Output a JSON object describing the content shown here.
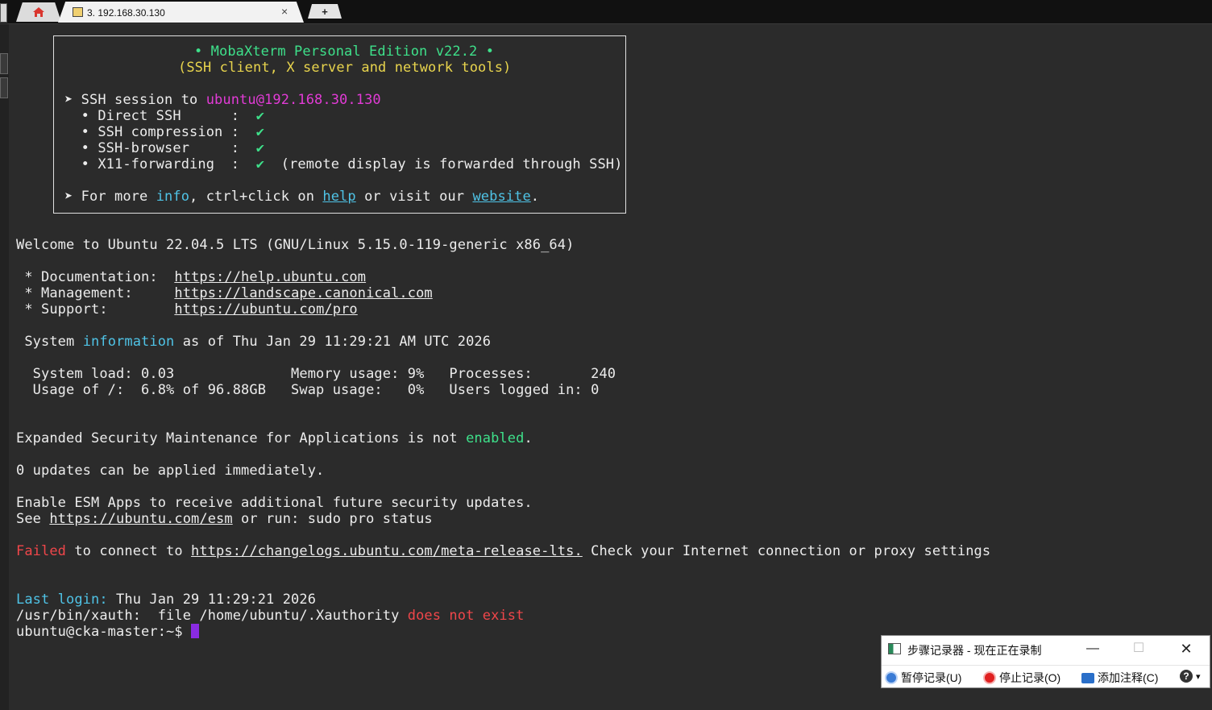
{
  "tabs": {
    "home_icon": "home-icon",
    "session_title": "3. 192.168.30.130",
    "close_glyph": "×",
    "new_tab_glyph": "+"
  },
  "banner": {
    "l1": "• MobaXterm Personal Edition v22.2 •",
    "l2": "(SSH client, X server and network tools)",
    "l3_pre": "➤ SSH session to ",
    "l3_host": "ubuntu@192.168.30.130",
    "l4_label": "  • Direct SSH      :  ",
    "l5_label": "  • SSH compression :  ",
    "l6_label": "  • SSH-browser     :  ",
    "l7_label": "  • X11-forwarding  :  ",
    "check": "✔",
    "l7_note": "  (remote display is forwarded through SSH)",
    "l8_pre": "➤ For more ",
    "l8_info": "info",
    "l8_mid": ", ctrl+click on ",
    "l8_help": "help",
    "l8_mid2": " or visit our ",
    "l8_website": "website",
    "l8_end": "."
  },
  "motd": {
    "welcome": "Welcome to Ubuntu 22.04.5 LTS (GNU/Linux 5.15.0-119-generic x86_64)",
    "doc_label": " * Documentation:  ",
    "doc_url": "https://help.ubuntu.com",
    "mgmt_label": " * Management:     ",
    "mgmt_url": "https://landscape.canonical.com",
    "support_label": " * Support:        ",
    "support_url": "https://ubuntu.com/pro",
    "sysinfo_pre": " System ",
    "sysinfo_word": "information",
    "sysinfo_post": " as of Thu Jan 29 11:29:21 AM UTC 2026",
    "stats1": "  System load: 0.03              Memory usage: 9%   Processes:       240",
    "stats2": "  Usage of /:  6.8% of 96.88GB   Swap usage:   0%   Users logged in: 0",
    "esm_pre": "Expanded Security Maintenance for Applications is not ",
    "esm_word": "enabled",
    "esm_end": ".",
    "updates": "0 updates can be applied immediately.",
    "enable_esm": "Enable ESM Apps to receive additional future security updates.",
    "see_pre": "See ",
    "see_url": "https://ubuntu.com/esm",
    "see_post": " or run: sudo pro status",
    "failed_word": "Failed",
    "failed_mid": " to connect to ",
    "failed_url": "https://changelogs.ubuntu.com/meta-release-lts.",
    "failed_post": " Check your Internet connection or proxy settings",
    "last_login_label": "Last login:",
    "last_login_value": " Thu Jan 29 11:29:21 2026",
    "xauth_pre": "/usr/bin/xauth:  file /home/ubuntu/.Xauthority ",
    "xauth_err": "does not exist",
    "prompt": "ubuntu@cka-master:~$ "
  },
  "steps_recorder": {
    "title": "步骤记录器 - 现在正在录制",
    "min_glyph": "—",
    "max_glyph": "☐",
    "close_glyph": "✕",
    "pause_label": "暂停记录(U)",
    "stop_label": "停止记录(O)",
    "comment_label": "添加注释(C)",
    "help_glyph": "?",
    "help_arrow": "▾"
  }
}
